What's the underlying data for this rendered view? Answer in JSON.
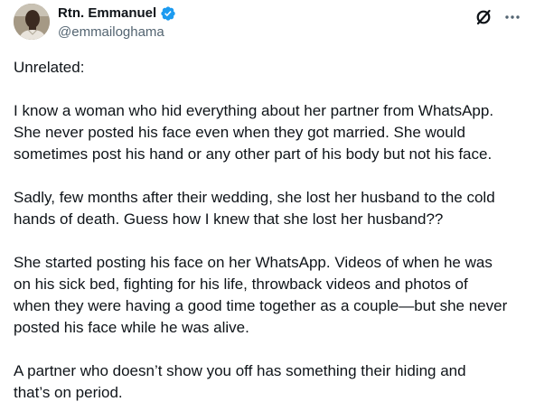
{
  "author": {
    "display_name": "Rtn. Emmanuel",
    "handle": "@emmailoghama",
    "verified": true,
    "verified_color": "#1d9bf0"
  },
  "header_icons": {
    "grok": "grok-icon",
    "more": "more-icon"
  },
  "post": {
    "paragraphs": [
      [
        "Unrelated:"
      ],
      [
        "I know a woman who hid everything about her partner from WhatsApp.",
        "She never posted his face even when they got married. She would",
        "sometimes post his hand or any other part of his body but not his face."
      ],
      [
        "Sadly, few months after their wedding, she lost her husband to the cold",
        "hands of death. Guess how I knew that she lost her husband??"
      ],
      [
        "She started posting his face on her WhatsApp. Videos of when he was",
        "on his sick bed, fighting for his life, throwback videos and photos of",
        "when they were having a good time together as a couple—but she never",
        "posted his face while he was alive."
      ],
      [
        "A partner who doesn’t show you off has something their hiding and",
        "that’s on period."
      ]
    ]
  }
}
